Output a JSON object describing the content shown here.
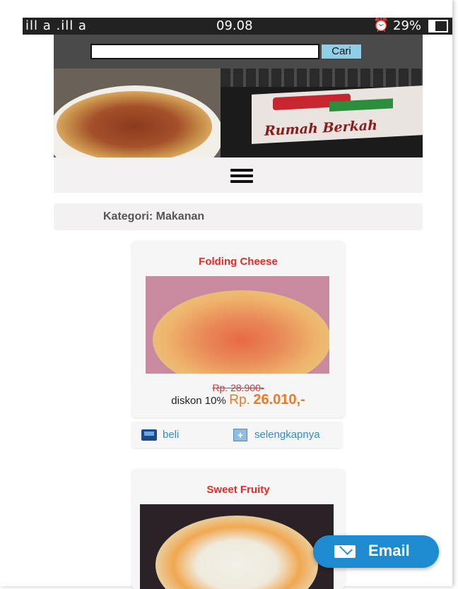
{
  "status_bar": {
    "left_indicators": "ill a .ill a",
    "time": "09.08",
    "alarm_icon": "alarm-icon",
    "battery": "29%"
  },
  "search": {
    "value": "",
    "button_label": "Cari"
  },
  "banner": {
    "sign_text": "Rumah Berkah"
  },
  "menu": {
    "icon": "hamburger-menu-icon"
  },
  "category": {
    "label": "Kategori: Makanan"
  },
  "products": [
    {
      "name": "Folding Cheese",
      "old_price": "Rp. 28.900-",
      "discount_label": "diskon 10%",
      "price_prefix": "Rp.",
      "price_value": "26.010,-"
    },
    {
      "name": "Sweet Fruity"
    }
  ],
  "actions": {
    "buy_label": "beli",
    "more_label": "selengkapnya"
  },
  "email_button": {
    "label": "Email"
  },
  "colors": {
    "title_red": "#e32b2b",
    "price_orange": "#f07820",
    "link_blue": "#2a8fd8",
    "email_blue": "#1e8ad0"
  }
}
